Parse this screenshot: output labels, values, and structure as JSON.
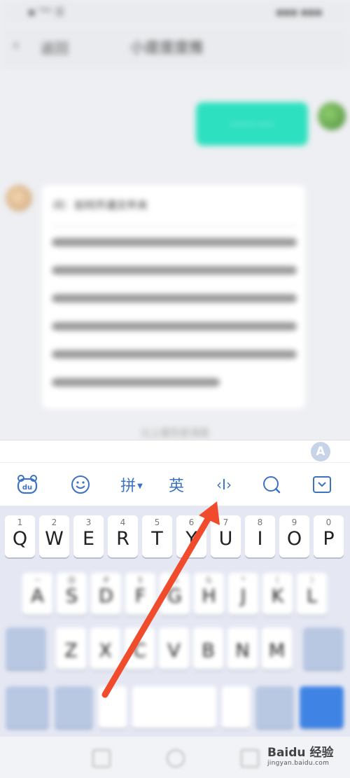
{
  "status_bar": {
    "left": "▪ ᵀ⁴ᴳ ☰",
    "right": "▪▪▪ ▪▪▪"
  },
  "nav": {
    "back_label": "返回",
    "title": "小度度度推"
  },
  "chat": {
    "outgoing": "——— ——",
    "question": "问：如何开通文件夹",
    "history_label": "以上是历史消息"
  },
  "keyboard": {
    "avatar_letter": "A",
    "toolbar": {
      "pinyin_label": "拼",
      "english_label": "英",
      "cursor_label": "‹I›"
    },
    "row1": [
      {
        "num": "1",
        "letter": "Q"
      },
      {
        "num": "2",
        "letter": "W"
      },
      {
        "num": "3",
        "letter": "E"
      },
      {
        "num": "4",
        "letter": "R"
      },
      {
        "num": "5",
        "letter": "T"
      },
      {
        "num": "6",
        "letter": "Y"
      },
      {
        "num": "7",
        "letter": "U"
      },
      {
        "num": "8",
        "letter": "I"
      },
      {
        "num": "9",
        "letter": "O"
      },
      {
        "num": "0",
        "letter": "P"
      }
    ],
    "row2": [
      {
        "sym": "~",
        "letter": "A"
      },
      {
        "sym": "@",
        "letter": "S"
      },
      {
        "sym": "#",
        "letter": "D"
      },
      {
        "sym": "$",
        "letter": "F"
      },
      {
        "sym": "%",
        "letter": "G"
      },
      {
        "sym": "&",
        "letter": "H"
      },
      {
        "sym": "*",
        "letter": "J"
      },
      {
        "sym": "(",
        "letter": "K"
      },
      {
        "sym": ")",
        "letter": "L"
      }
    ],
    "row3": [
      "Z",
      "X",
      "C",
      "V",
      "B",
      "N",
      "M"
    ]
  },
  "watermark": {
    "main": "Baidu 经验",
    "sub": "jingyan.baidu.com"
  },
  "colors": {
    "accent": "#3b73c4",
    "arrow": "#f04b2c",
    "bubble_out": "#2de0bf",
    "enter_key": "#3f84e4"
  }
}
